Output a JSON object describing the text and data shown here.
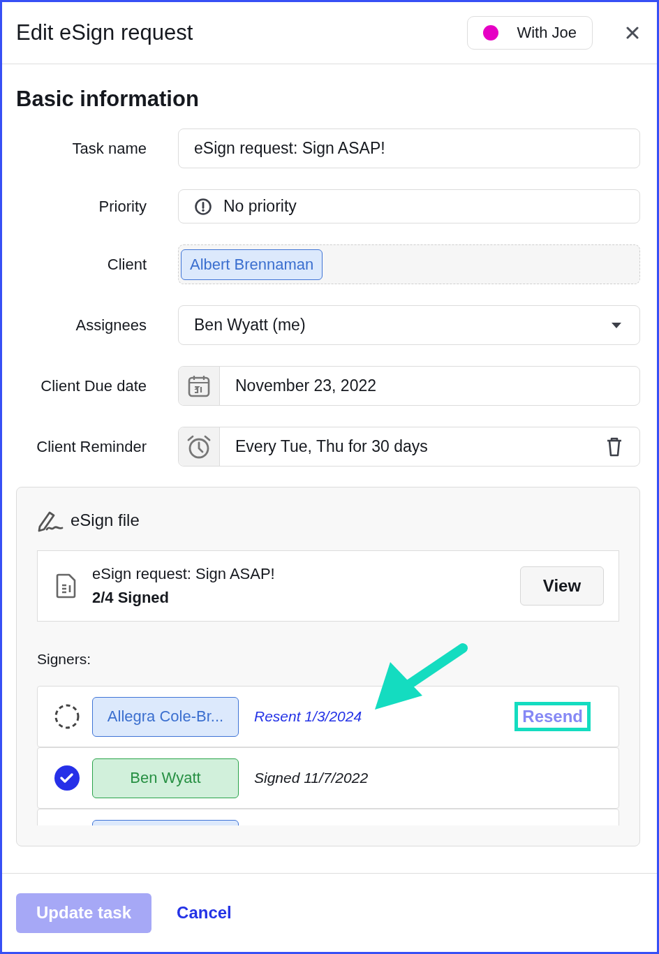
{
  "header": {
    "title": "Edit eSign request",
    "status": {
      "label": "With Joe",
      "color": "#e600c4"
    }
  },
  "section_title": "Basic information",
  "fields": [
    {
      "kind": "text",
      "label": "Task name",
      "value": "eSign request: Sign ASAP!"
    },
    {
      "kind": "priority",
      "label": "Priority",
      "value": "No priority"
    },
    {
      "kind": "chip",
      "label": "Client",
      "value": "Albert Brennaman"
    },
    {
      "kind": "select",
      "label": "Assignees",
      "value": "Ben Wyatt (me)"
    },
    {
      "kind": "date",
      "label": "Client Due date",
      "value": "November 23, 2022"
    },
    {
      "kind": "reminder",
      "label": "Client Reminder",
      "value": "Every Tue, Thu for 30 days"
    }
  ],
  "esign": {
    "title": "eSign file",
    "file_name": "eSign request: Sign ASAP!",
    "progress": "2/4 Signed",
    "view_button": "View",
    "signers_label": "Signers:",
    "signers": [
      {
        "name": "Allegra Cole-Br...",
        "signed": false,
        "status": "Resent 1/3/2024",
        "kind": "resent",
        "action": "Resend",
        "highlighted": true,
        "arrow": true
      },
      {
        "name": "Ben Wyatt",
        "signed": true,
        "status": "Signed 11/7/2022",
        "kind": "signed"
      },
      {
        "signed": false
      }
    ]
  },
  "footer": {
    "primary": {
      "label": "Update task",
      "disabled": true
    },
    "secondary": "Cancel"
  }
}
